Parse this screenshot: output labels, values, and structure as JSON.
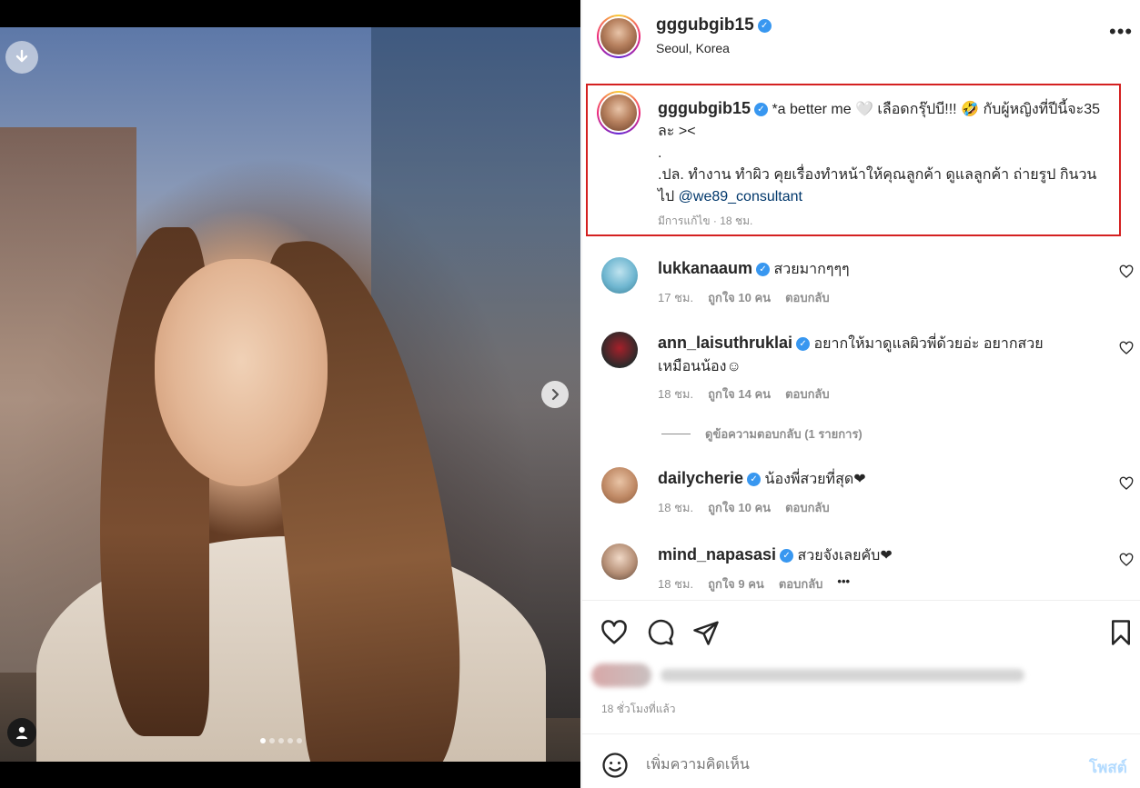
{
  "post": {
    "username": "gggubgib15",
    "location": "Seoul, Korea"
  },
  "caption": {
    "username": "gggubgib15",
    "line1": "*a better me 🤍 เลือดกรุ๊ปบี!!! 🤣 กับผู้หญิงที่ปีนี้จะ35 ละ ><",
    "dot": ".",
    "line2": ".ปล. ทำงาน ทำผิว คุยเรื่องทำหน้าให้คุณลูกค้า ดูแลลูกค้า ถ่ายรูป กินวนไป",
    "mention": "@we89_consultant",
    "meta": "มีการแก้ไข · 18 ชม."
  },
  "comments": [
    {
      "username": "lukkanaaum",
      "text": "สวยมากๆๆๆ",
      "time": "17 ชม.",
      "likes": "ถูกใจ 10 คน",
      "reply": "ตอบกลับ"
    },
    {
      "username": "ann_laisuthruklai",
      "text": "อยากให้มาดูแลผิวพี่ด้วยอ่ะ อยากสวยเหมือนน้อง☺",
      "time": "18 ชม.",
      "likes": "ถูกใจ 14 คน",
      "reply": "ตอบกลับ"
    },
    {
      "username": "dailycherie",
      "text": "น้องพี่สวยที่สุด❤",
      "time": "18 ชม.",
      "likes": "ถูกใจ 10 คน",
      "reply": "ตอบกลับ"
    },
    {
      "username": "mind_napasasi",
      "text": "สวยจังเลยคับ❤",
      "time": "18 ชม.",
      "likes": "ถูกใจ 9 คน",
      "reply": "ตอบกลับ",
      "more": "•••"
    }
  ],
  "view_replies": "ดูข้อความตอบกลับ (1 รายการ)",
  "time_ago": "18 ชั่วโมงที่แล้ว",
  "comment_box": {
    "placeholder": "เพิ่มความคิดเห็น",
    "post_label": "โพสต์"
  },
  "carousel": {
    "total": 5,
    "current": 1
  },
  "icons": [
    "download-icon",
    "next-icon",
    "user-tag-icon",
    "more-options-icon",
    "verified-icon",
    "heart-icon",
    "comment-icon",
    "share-icon",
    "bookmark-icon",
    "emoji-icon"
  ],
  "colors": {
    "accent": "#3897f0",
    "highlight_border": "#d42020",
    "mention": "#00376b",
    "post_disabled": "#b3dbff"
  }
}
